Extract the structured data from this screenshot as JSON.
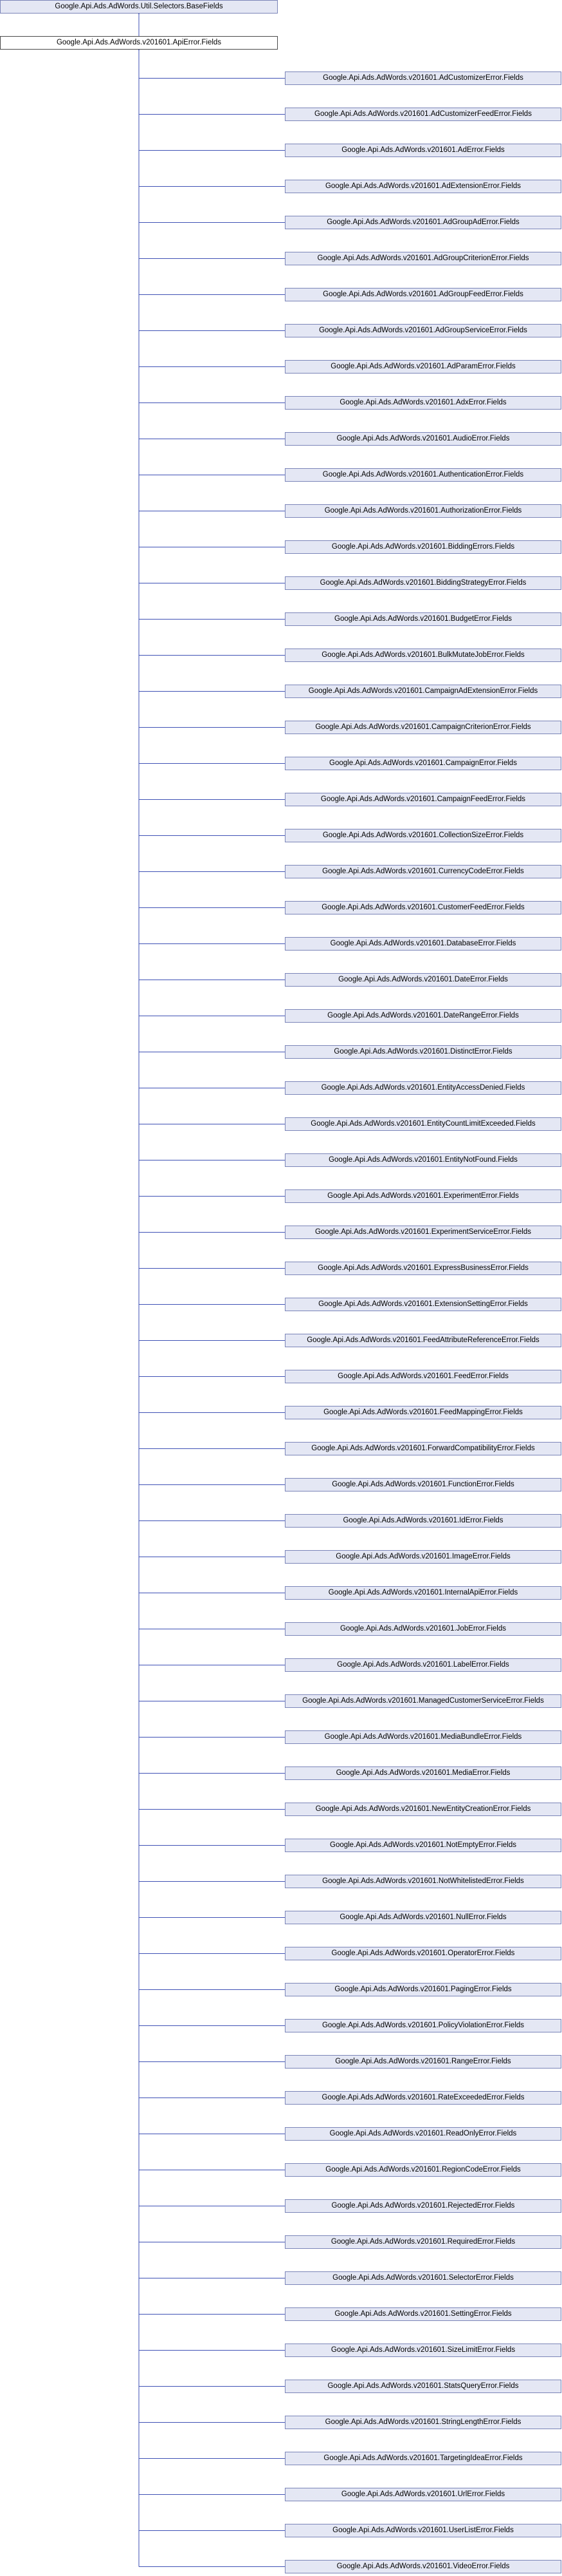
{
  "base_class": "Google.Api.Ads.AdWords.Util.Selectors.BaseFields",
  "current_class": "Google.Api.Ads.AdWords.v201601.ApiError.Fields",
  "derived_classes": [
    "Google.Api.Ads.AdWords.v201601.AdCustomizerError.Fields",
    "Google.Api.Ads.AdWords.v201601.AdCustomizerFeedError.Fields",
    "Google.Api.Ads.AdWords.v201601.AdError.Fields",
    "Google.Api.Ads.AdWords.v201601.AdExtensionError.Fields",
    "Google.Api.Ads.AdWords.v201601.AdGroupAdError.Fields",
    "Google.Api.Ads.AdWords.v201601.AdGroupCriterionError.Fields",
    "Google.Api.Ads.AdWords.v201601.AdGroupFeedError.Fields",
    "Google.Api.Ads.AdWords.v201601.AdGroupServiceError.Fields",
    "Google.Api.Ads.AdWords.v201601.AdParamError.Fields",
    "Google.Api.Ads.AdWords.v201601.AdxError.Fields",
    "Google.Api.Ads.AdWords.v201601.AudioError.Fields",
    "Google.Api.Ads.AdWords.v201601.AuthenticationError.Fields",
    "Google.Api.Ads.AdWords.v201601.AuthorizationError.Fields",
    "Google.Api.Ads.AdWords.v201601.BiddingErrors.Fields",
    "Google.Api.Ads.AdWords.v201601.BiddingStrategyError.Fields",
    "Google.Api.Ads.AdWords.v201601.BudgetError.Fields",
    "Google.Api.Ads.AdWords.v201601.BulkMutateJobError.Fields",
    "Google.Api.Ads.AdWords.v201601.CampaignAdExtensionError.Fields",
    "Google.Api.Ads.AdWords.v201601.CampaignCriterionError.Fields",
    "Google.Api.Ads.AdWords.v201601.CampaignError.Fields",
    "Google.Api.Ads.AdWords.v201601.CampaignFeedError.Fields",
    "Google.Api.Ads.AdWords.v201601.CollectionSizeError.Fields",
    "Google.Api.Ads.AdWords.v201601.CurrencyCodeError.Fields",
    "Google.Api.Ads.AdWords.v201601.CustomerFeedError.Fields",
    "Google.Api.Ads.AdWords.v201601.DatabaseError.Fields",
    "Google.Api.Ads.AdWords.v201601.DateError.Fields",
    "Google.Api.Ads.AdWords.v201601.DateRangeError.Fields",
    "Google.Api.Ads.AdWords.v201601.DistinctError.Fields",
    "Google.Api.Ads.AdWords.v201601.EntityAccessDenied.Fields",
    "Google.Api.Ads.AdWords.v201601.EntityCountLimitExceeded.Fields",
    "Google.Api.Ads.AdWords.v201601.EntityNotFound.Fields",
    "Google.Api.Ads.AdWords.v201601.ExperimentError.Fields",
    "Google.Api.Ads.AdWords.v201601.ExperimentServiceError.Fields",
    "Google.Api.Ads.AdWords.v201601.ExpressBusinessError.Fields",
    "Google.Api.Ads.AdWords.v201601.ExtensionSettingError.Fields",
    "Google.Api.Ads.AdWords.v201601.FeedAttributeReferenceError.Fields",
    "Google.Api.Ads.AdWords.v201601.FeedError.Fields",
    "Google.Api.Ads.AdWords.v201601.FeedMappingError.Fields",
    "Google.Api.Ads.AdWords.v201601.ForwardCompatibilityError.Fields",
    "Google.Api.Ads.AdWords.v201601.FunctionError.Fields",
    "Google.Api.Ads.AdWords.v201601.IdError.Fields",
    "Google.Api.Ads.AdWords.v201601.ImageError.Fields",
    "Google.Api.Ads.AdWords.v201601.InternalApiError.Fields",
    "Google.Api.Ads.AdWords.v201601.JobError.Fields",
    "Google.Api.Ads.AdWords.v201601.LabelError.Fields",
    "Google.Api.Ads.AdWords.v201601.ManagedCustomerServiceError.Fields",
    "Google.Api.Ads.AdWords.v201601.MediaBundleError.Fields",
    "Google.Api.Ads.AdWords.v201601.MediaError.Fields",
    "Google.Api.Ads.AdWords.v201601.NewEntityCreationError.Fields",
    "Google.Api.Ads.AdWords.v201601.NotEmptyError.Fields",
    "Google.Api.Ads.AdWords.v201601.NotWhitelistedError.Fields",
    "Google.Api.Ads.AdWords.v201601.NullError.Fields",
    "Google.Api.Ads.AdWords.v201601.OperatorError.Fields",
    "Google.Api.Ads.AdWords.v201601.PagingError.Fields",
    "Google.Api.Ads.AdWords.v201601.PolicyViolationError.Fields",
    "Google.Api.Ads.AdWords.v201601.RangeError.Fields",
    "Google.Api.Ads.AdWords.v201601.RateExceededError.Fields",
    "Google.Api.Ads.AdWords.v201601.ReadOnlyError.Fields",
    "Google.Api.Ads.AdWords.v201601.RegionCodeError.Fields",
    "Google.Api.Ads.AdWords.v201601.RejectedError.Fields",
    "Google.Api.Ads.AdWords.v201601.RequiredError.Fields",
    "Google.Api.Ads.AdWords.v201601.SelectorError.Fields",
    "Google.Api.Ads.AdWords.v201601.SettingError.Fields",
    "Google.Api.Ads.AdWords.v201601.SizeLimitError.Fields",
    "Google.Api.Ads.AdWords.v201601.StatsQueryError.Fields",
    "Google.Api.Ads.AdWords.v201601.StringLengthError.Fields",
    "Google.Api.Ads.AdWords.v201601.TargetingIdeaError.Fields",
    "Google.Api.Ads.AdWords.v201601.UrlError.Fields",
    "Google.Api.Ads.AdWords.v201601.UserListError.Fields",
    "Google.Api.Ads.AdWords.v201601.VideoError.Fields"
  ],
  "colors": {
    "edge": "#3f51b5",
    "node_fill": "#e4e7f4",
    "node_border": "#7b85b8"
  }
}
